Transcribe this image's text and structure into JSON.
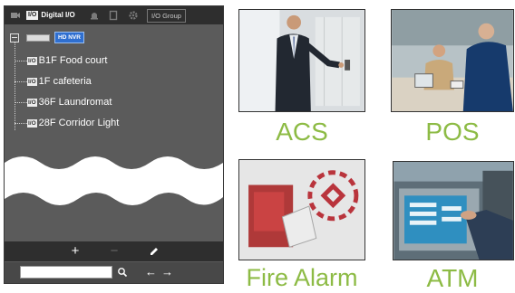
{
  "panel": {
    "tabs": {
      "digital_io": "Digital I/O",
      "io_badge": "I/O",
      "group": "I/O Group"
    },
    "tree": {
      "root_badge": "HD NVR",
      "item_icon": "I/O",
      "items": [
        {
          "label": "B1F Food court"
        },
        {
          "label": "1F cafeteria"
        },
        {
          "label": "36F Laundromat"
        },
        {
          "label": "28F Corridor Light"
        }
      ]
    },
    "toolbar": {
      "add": "+",
      "remove": "−"
    },
    "search": {
      "value": "",
      "placeholder": ""
    }
  },
  "tiles": [
    {
      "caption": "ACS"
    },
    {
      "caption": "POS"
    },
    {
      "caption": "Fire Alarm"
    },
    {
      "caption": "ATM"
    }
  ],
  "colors": {
    "caption": "#8dbb45",
    "panel_bg": "#5b5b5b",
    "panel_bar": "#2e2e2e",
    "nvr_badge": "#2f6fd0"
  }
}
